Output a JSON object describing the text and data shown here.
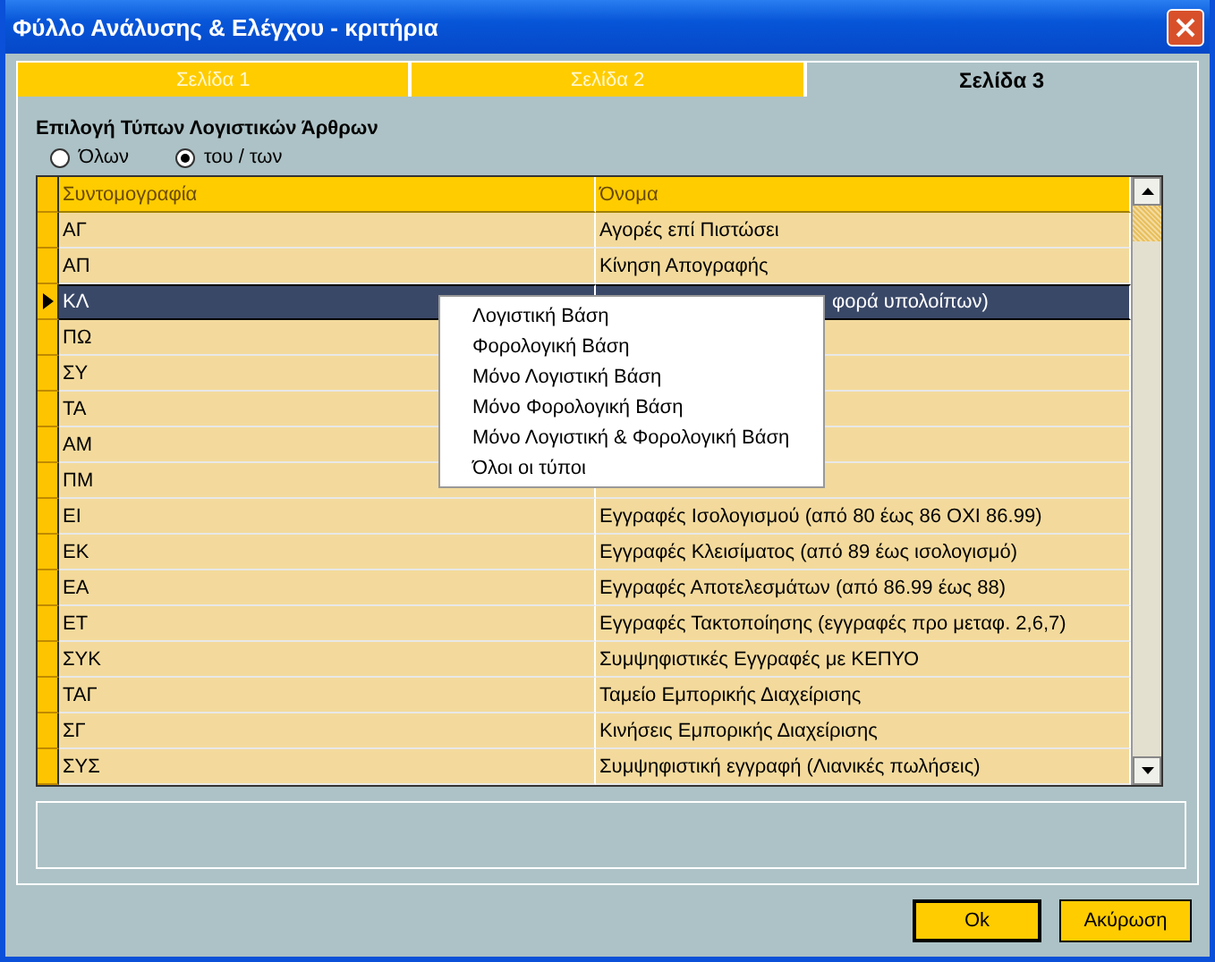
{
  "window": {
    "title": "Φύλλο Ανάλυσης & Ελέγχου - κριτήρια"
  },
  "tabs": [
    {
      "label": "Σελίδα 1",
      "selected": false
    },
    {
      "label": "Σελίδα 2",
      "selected": false
    },
    {
      "label": "Σελίδα 3",
      "selected": true
    }
  ],
  "group": {
    "title": "Επιλογή Τύπων Λογιστικών Άρθρων",
    "radios": [
      {
        "label": "Όλων",
        "selected": false
      },
      {
        "label": "του / των",
        "selected": true
      }
    ]
  },
  "table": {
    "columns": [
      "Συντομογραφία",
      "Όνομα"
    ],
    "rows": [
      {
        "code": "ΑΓ",
        "name": "Αγορές επί Πιστώσει",
        "selected": false
      },
      {
        "code": "ΑΠ",
        "name": "Κίνηση Απογραφής",
        "selected": false
      },
      {
        "code": "ΚΛ",
        "name": "φορά υπολοίπων)",
        "selected": true,
        "partly_covered": true
      },
      {
        "code": "ΠΩ",
        "selected": false
      },
      {
        "code": "ΣΥ",
        "selected": false
      },
      {
        "code": "ΤΑ",
        "selected": false
      },
      {
        "code": "ΑΜ",
        "selected": false
      },
      {
        "code": "ΠΜ",
        "selected": false
      },
      {
        "code": "ΕΙ",
        "name": "Εγγραφές Ισολογισμού (από 80 έως 86 ΟΧΙ 86.99)",
        "selected": false
      },
      {
        "code": "ΕΚ",
        "name": "Εγγραφές Κλεισίματος (από 89 έως ισολογισμό)",
        "selected": false
      },
      {
        "code": "ΕΑ",
        "name": "Εγγραφές Αποτελεσμάτων (από 86.99 έως 88)",
        "selected": false
      },
      {
        "code": "ΕΤ",
        "name": "Εγγραφές Τακτοποίησης (εγγραφές προ μεταφ. 2,6,7)",
        "selected": false
      },
      {
        "code": "ΣΥΚ",
        "name": "Συμψηφιστικές Εγγραφές με ΚΕΠΥΟ",
        "selected": false
      },
      {
        "code": "ΤΑΓ",
        "name": "Ταμείο Εμπορικής Διαχείρισης",
        "selected": false
      },
      {
        "code": "ΣΓ",
        "name": "Κινήσεις Εμπορικής Διαχείρισης",
        "selected": false
      },
      {
        "code": "ΣΥΣ",
        "name": "Συμψηφιστική εγγραφή (Λιανικές πωλήσεις)",
        "selected": false
      }
    ]
  },
  "context_menu": {
    "items": [
      "Λογιστική Βάση",
      "Φορολογική Βάση",
      "Μόνο Λογιστική Βάση",
      "Μόνο Φορολογική Βάση",
      "Μόνο Λογιστική & Φορολογική Βάση",
      "Όλοι οι τύποι"
    ]
  },
  "buttons": [
    {
      "label": "Ok",
      "kind": "default"
    },
    {
      "label": "Ακύρωση",
      "kind": "normal"
    }
  ]
}
